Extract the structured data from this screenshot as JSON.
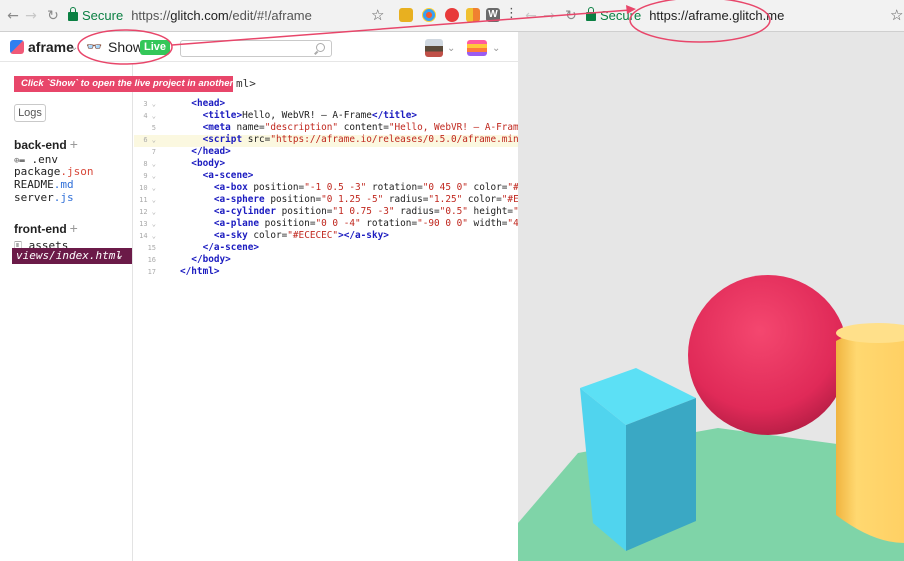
{
  "left_browser": {
    "secure_label": "Secure",
    "url_prefix": "https://",
    "url_host": "glitch.com",
    "url_path": "/edit/#!/aframe"
  },
  "glitch": {
    "project_name": "aframe",
    "show_label": "Show",
    "live_badge": "Live",
    "tooltip": "Click `Show` to open the live project in another tab",
    "tooltip_tail": "ml>"
  },
  "sidebar": {
    "logs_label": "Logs",
    "backend_title": "back-end",
    "backend_files": [
      {
        "name": ".env",
        "ext": ""
      },
      {
        "name": "package",
        "ext": ".json"
      },
      {
        "name": "README",
        "ext": ".md"
      },
      {
        "name": "server",
        "ext": ".js"
      }
    ],
    "frontend_title": "front-end",
    "assets_label": "assets",
    "active_file": "views/index.html"
  },
  "editor": {
    "lines": [
      {
        "n": "3",
        "fold": true
      },
      {
        "n": "4",
        "fold": true
      },
      {
        "n": "5",
        "fold": false
      },
      {
        "n": "6",
        "fold": true
      },
      {
        "n": "7",
        "fold": false
      },
      {
        "n": "8",
        "fold": true
      },
      {
        "n": "9",
        "fold": true
      },
      {
        "n": "10",
        "fold": true
      },
      {
        "n": "11",
        "fold": true
      },
      {
        "n": "12",
        "fold": true
      },
      {
        "n": "13",
        "fold": true
      },
      {
        "n": "14",
        "fold": true
      },
      {
        "n": "15",
        "fold": false
      },
      {
        "n": "16",
        "fold": false
      },
      {
        "n": "17",
        "fold": false
      }
    ]
  },
  "right_browser": {
    "secure_label": "Secure",
    "url": "https://aframe.glitch.me"
  },
  "colors": {
    "live_green": "#34c759",
    "annotation_red": "#e8466a",
    "active_file_bg": "#6b1a48",
    "sphere": "#EF2D5E",
    "box": "#4CC3D9",
    "cylinder": "#FFC65D",
    "plane": "#7BC8A4",
    "sky": "#ECECEC"
  }
}
